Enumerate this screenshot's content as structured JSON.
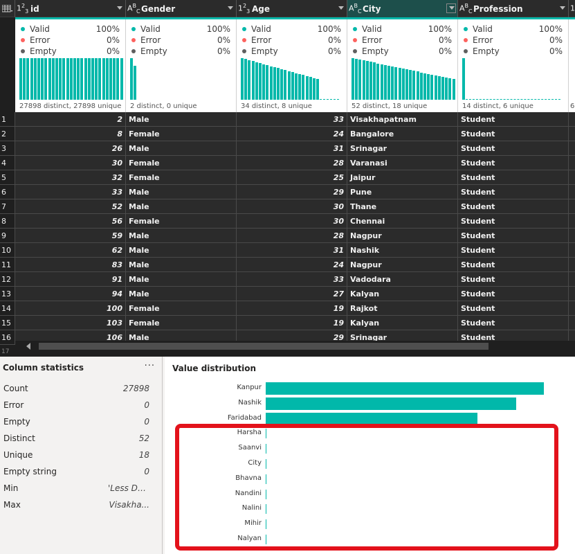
{
  "columns": [
    {
      "name": "id",
      "type_icon": "123",
      "valid": "100%",
      "error": "0%",
      "empty": "0%",
      "distinct": "27898 distinct, 27898 unique"
    },
    {
      "name": "Gender",
      "type_icon": "ABC",
      "valid": "100%",
      "error": "0%",
      "empty": "0%",
      "distinct": "2 distinct, 0 unique"
    },
    {
      "name": "Age",
      "type_icon": "123",
      "valid": "100%",
      "error": "0%",
      "empty": "0%",
      "distinct": "34 distinct, 8 unique"
    },
    {
      "name": "City",
      "type_icon": "ABC",
      "valid": "100%",
      "error": "0%",
      "empty": "0%",
      "distinct": "52 distinct, 18 unique"
    },
    {
      "name": "Profession",
      "type_icon": "ABC",
      "valid": "100%",
      "error": "0%",
      "empty": "0%",
      "distinct": "14 distinct, 6 unique"
    },
    {
      "name": "",
      "type_icon": "123",
      "valid": "",
      "error": "",
      "empty": "",
      "distinct": "6"
    }
  ],
  "quality_labels": {
    "valid": "Valid",
    "error": "Error",
    "empty": "Empty"
  },
  "colors": {
    "valid": "#01b8aa",
    "error": "#fd625e",
    "empty": "#5f5f5f",
    "highlight": "#e3121b"
  },
  "rows": [
    {
      "n": "1",
      "id": "2",
      "gender": "Male",
      "age": "33",
      "city": "Visakhapatnam",
      "profession": "Student"
    },
    {
      "n": "2",
      "id": "8",
      "gender": "Female",
      "age": "24",
      "city": "Bangalore",
      "profession": "Student"
    },
    {
      "n": "3",
      "id": "26",
      "gender": "Male",
      "age": "31",
      "city": "Srinagar",
      "profession": "Student"
    },
    {
      "n": "4",
      "id": "30",
      "gender": "Female",
      "age": "28",
      "city": "Varanasi",
      "profession": "Student"
    },
    {
      "n": "5",
      "id": "32",
      "gender": "Female",
      "age": "25",
      "city": "Jaipur",
      "profession": "Student"
    },
    {
      "n": "6",
      "id": "33",
      "gender": "Male",
      "age": "29",
      "city": "Pune",
      "profession": "Student"
    },
    {
      "n": "7",
      "id": "52",
      "gender": "Male",
      "age": "30",
      "city": "Thane",
      "profession": "Student"
    },
    {
      "n": "8",
      "id": "56",
      "gender": "Female",
      "age": "30",
      "city": "Chennai",
      "profession": "Student"
    },
    {
      "n": "9",
      "id": "59",
      "gender": "Male",
      "age": "28",
      "city": "Nagpur",
      "profession": "Student"
    },
    {
      "n": "10",
      "id": "62",
      "gender": "Male",
      "age": "31",
      "city": "Nashik",
      "profession": "Student"
    },
    {
      "n": "11",
      "id": "83",
      "gender": "Male",
      "age": "24",
      "city": "Nagpur",
      "profession": "Student"
    },
    {
      "n": "12",
      "id": "91",
      "gender": "Male",
      "age": "33",
      "city": "Vadodara",
      "profession": "Student"
    },
    {
      "n": "13",
      "id": "94",
      "gender": "Male",
      "age": "27",
      "city": "Kalyan",
      "profession": "Student"
    },
    {
      "n": "14",
      "id": "100",
      "gender": "Female",
      "age": "19",
      "city": "Rajkot",
      "profession": "Student"
    },
    {
      "n": "15",
      "id": "103",
      "gender": "Female",
      "age": "19",
      "city": "Kalyan",
      "profession": "Student"
    },
    {
      "n": "16",
      "id": "106",
      "gender": "Male",
      "age": "29",
      "city": "Srinagar",
      "profession": "Student"
    }
  ],
  "row17_label": "17",
  "stats": {
    "title": "Column statistics",
    "more": "···",
    "items": [
      {
        "k": "Count",
        "v": "27898"
      },
      {
        "k": "Error",
        "v": "0"
      },
      {
        "k": "Empty",
        "v": "0"
      },
      {
        "k": "Distinct",
        "v": "52"
      },
      {
        "k": "Unique",
        "v": "18"
      },
      {
        "k": "Empty string",
        "v": "0"
      },
      {
        "k": "Min",
        "v": "'Less Del..."
      },
      {
        "k": "Max",
        "v": "Visakha..."
      }
    ]
  },
  "distribution": {
    "title": "Value distribution",
    "items": [
      {
        "label": "Kanpur",
        "fraction": 1.0
      },
      {
        "label": "Nashik",
        "fraction": 0.9
      },
      {
        "label": "Faridabad",
        "fraction": 0.76
      },
      {
        "label": "Harsha",
        "fraction": 0.0
      },
      {
        "label": "Saanvi",
        "fraction": 0.0
      },
      {
        "label": "City",
        "fraction": 0.0
      },
      {
        "label": "Bhavna",
        "fraction": 0.0
      },
      {
        "label": "Nandini",
        "fraction": 0.0
      },
      {
        "label": "Nalini",
        "fraction": 0.0
      },
      {
        "label": "Mihir",
        "fraction": 0.0
      },
      {
        "label": "Nalyan",
        "fraction": 0.0
      }
    ]
  }
}
